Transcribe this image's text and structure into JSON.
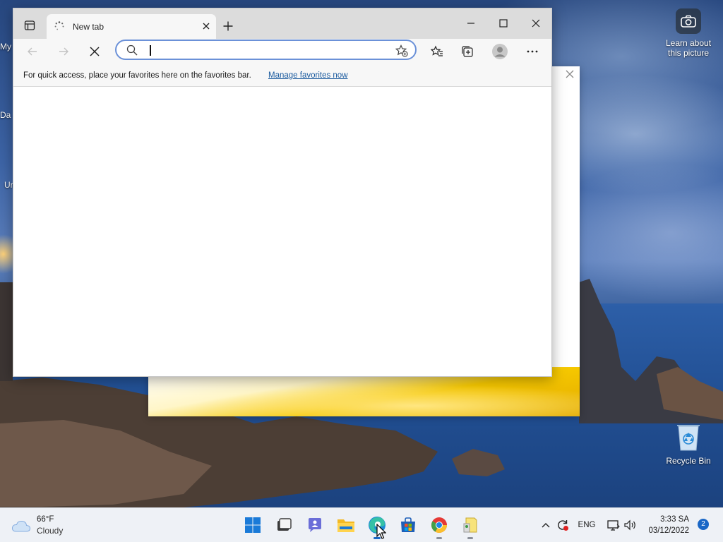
{
  "desktop": {
    "icons": {
      "learn_about": "Learn about this picture",
      "recycle_bin": "Recycle Bin"
    },
    "edge_labels": [
      "My",
      "Da",
      "Ur"
    ]
  },
  "browser": {
    "tab": {
      "title": "New tab",
      "state": "loading"
    },
    "toolbar": {
      "address_value": "",
      "address_placeholder": ""
    },
    "favorites_bar": {
      "message": "For quick access, place your favorites here on the favorites bar.",
      "link": "Manage favorites now"
    },
    "icons": [
      "tab-actions-icon",
      "spinner-icon",
      "close-icon",
      "plus-icon",
      "minimize-icon",
      "maximize-icon",
      "close-window-icon",
      "back-icon",
      "forward-icon",
      "stop-icon",
      "search-icon",
      "add-favorite-icon",
      "favorites-icon",
      "collections-icon",
      "profile-icon",
      "more-icon"
    ]
  },
  "taskbar": {
    "weather": {
      "temp": "66°F",
      "condition": "Cloudy"
    },
    "apps": [
      "start",
      "task-view",
      "chat",
      "file-explorer",
      "edge",
      "microsoft-store",
      "chrome",
      "document-app"
    ],
    "tray": {
      "language": "ENG"
    },
    "clock": {
      "time": "3:33 SA",
      "date": "03/12/2022"
    },
    "notification_count": "2"
  },
  "colors": {
    "accent": "#1a67c6",
    "focus_ring": "#6b91d8",
    "link": "#1a5a9e",
    "taskbar": "#eef1f6"
  }
}
